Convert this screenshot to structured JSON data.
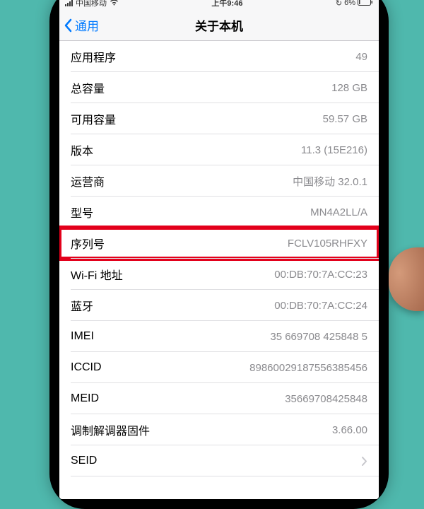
{
  "statusBar": {
    "carrier": "中国移动",
    "time": "上午9:46",
    "battery": "6%"
  },
  "nav": {
    "back": "通用",
    "title": "关于本机"
  },
  "rows": [
    {
      "label": "应用程序",
      "value": "49"
    },
    {
      "label": "总容量",
      "value": "128 GB"
    },
    {
      "label": "可用容量",
      "value": "59.57 GB"
    },
    {
      "label": "版本",
      "value": "11.3 (15E216)"
    },
    {
      "label": "运营商",
      "value": "中国移动 32.0.1"
    },
    {
      "label": "型号",
      "value": "MN4A2LL/A"
    },
    {
      "label": "序列号",
      "value": "FCLV105RHFXY"
    },
    {
      "label": "Wi-Fi 地址",
      "value": "00:DB:70:7A:CC:23"
    },
    {
      "label": "蓝牙",
      "value": "00:DB:70:7A:CC:24"
    },
    {
      "label": "IMEI",
      "value": "35 669708 425848 5"
    },
    {
      "label": "ICCID",
      "value": "89860029187556385456"
    },
    {
      "label": "MEID",
      "value": "35669708425848"
    },
    {
      "label": "调制解调器固件",
      "value": "3.66.00"
    },
    {
      "label": "SEID",
      "value": ""
    }
  ]
}
